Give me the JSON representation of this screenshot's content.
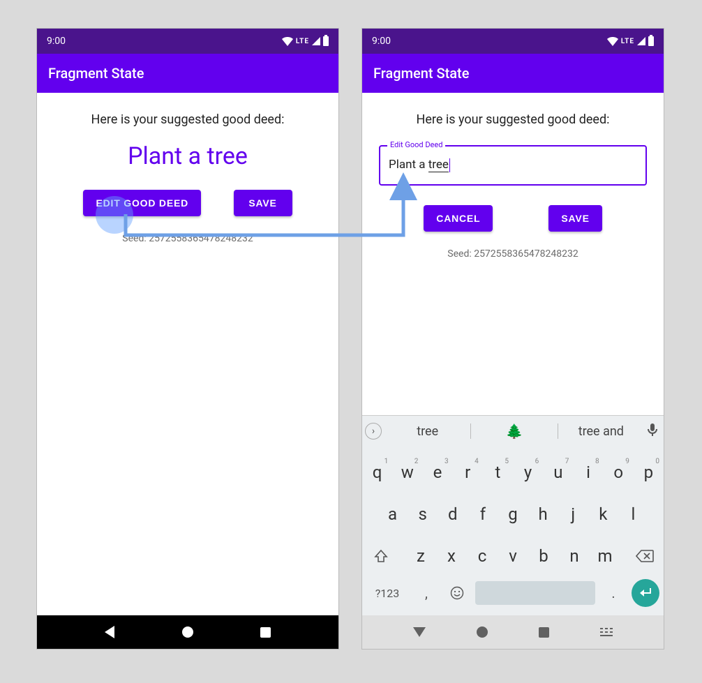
{
  "status": {
    "time": "9:00",
    "lte": "LTE"
  },
  "appBarTitle": "Fragment State",
  "prompt": "Here is your suggested good deed:",
  "deed": "Plant a tree",
  "buttons": {
    "edit": "EDIT GOOD DEED",
    "save": "SAVE",
    "cancel": "CANCEL"
  },
  "seedText": "Seed: 2572558365478248232",
  "field": {
    "label": "Edit Good Deed",
    "valuePlain": "Plant a ",
    "valueUnderlined": "tree"
  },
  "suggestions": {
    "s1": "tree",
    "s2": "🌲",
    "s3": "tree and"
  },
  "keyboard": {
    "row1": [
      "q",
      "w",
      "e",
      "r",
      "t",
      "y",
      "u",
      "i",
      "o",
      "p"
    ],
    "nums": [
      "1",
      "2",
      "3",
      "4",
      "5",
      "6",
      "7",
      "8",
      "9",
      "0"
    ],
    "row2": [
      "a",
      "s",
      "d",
      "f",
      "g",
      "h",
      "j",
      "k",
      "l"
    ],
    "row3": [
      "z",
      "x",
      "c",
      "v",
      "b",
      "n",
      "m"
    ],
    "sym": "?123",
    "comma": ",",
    "dot": "."
  }
}
